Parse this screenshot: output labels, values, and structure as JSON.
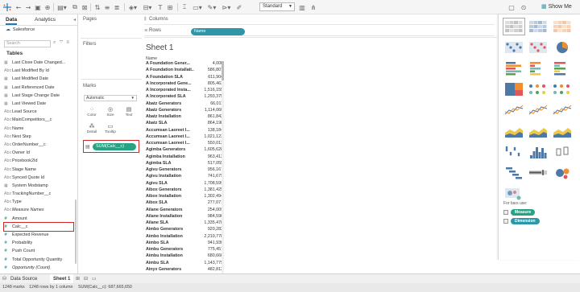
{
  "toolbar": {
    "mark_size_select": "Standard",
    "show_me_label": "Show Me"
  },
  "data_pane": {
    "tabs": [
      "Data",
      "Analytics"
    ],
    "datasource": "Salesforce",
    "search_placeholder": "Search",
    "tables_heading": "Tables",
    "fields": [
      {
        "name": "Last Close Date Changed...",
        "kind": "date"
      },
      {
        "name": "Last Modified By Id",
        "kind": "dim"
      },
      {
        "name": "Last Modified Date",
        "kind": "date"
      },
      {
        "name": "Last Referenced Date",
        "kind": "date"
      },
      {
        "name": "Last Stage Change Date",
        "kind": "date"
      },
      {
        "name": "Last Viewed Date",
        "kind": "date"
      },
      {
        "name": "Lead Source",
        "kind": "dim"
      },
      {
        "name": "MainCompetitors__c",
        "kind": "dim"
      },
      {
        "name": "Name",
        "kind": "dim"
      },
      {
        "name": "Next Step",
        "kind": "dim"
      },
      {
        "name": "OrderNumber__c",
        "kind": "dim"
      },
      {
        "name": "Owner Id",
        "kind": "dim"
      },
      {
        "name": "Pricebook2Id",
        "kind": "dim"
      },
      {
        "name": "Stage Name",
        "kind": "dim"
      },
      {
        "name": "Synced Quote Id",
        "kind": "dim"
      },
      {
        "name": "System Modstamp",
        "kind": "date"
      },
      {
        "name": "TrackingNumber__c",
        "kind": "dim"
      },
      {
        "name": "Type",
        "kind": "dim"
      },
      {
        "name": "Measure Names",
        "kind": "dim-italic"
      },
      {
        "name": "Amount",
        "kind": "measure"
      },
      {
        "name": "Calc__c",
        "kind": "measure"
      },
      {
        "name": "Expected Revenue",
        "kind": "measure"
      },
      {
        "name": "Probability",
        "kind": "measure"
      },
      {
        "name": "Push Count",
        "kind": "measure"
      },
      {
        "name": "Total Opportunity Quantity",
        "kind": "measure"
      },
      {
        "name": "Opportunity (Count)",
        "kind": "measure-italic"
      },
      {
        "name": "Measure Values",
        "kind": "measure-italic"
      }
    ],
    "selected_field": "Calc__c"
  },
  "cards": {
    "pages": "Pages",
    "filters": "Filters",
    "marks": "Marks",
    "mark_type": "Automatic",
    "mark_buttons": [
      "Color",
      "Size",
      "Text",
      "Detail",
      "Tooltip"
    ],
    "mark_pill": "SUM(Calc__c)"
  },
  "shelves": {
    "columns_label": "Columns",
    "rows_label": "Rows",
    "rows_pill": "Name"
  },
  "view": {
    "sheet_title": "Sheet 1",
    "column_header": "Name",
    "rows": [
      {
        "name": "A Foundation Gener...",
        "value": "4,000"
      },
      {
        "name": "A Foundation Installati...",
        "value": "586,807"
      },
      {
        "name": "A Foundation SLA",
        "value": "611,904"
      },
      {
        "name": "A Incorporated Gene...",
        "value": "805,463"
      },
      {
        "name": "A Incorporated Insta...",
        "value": "1,516,155"
      },
      {
        "name": "A Incorporated SLA",
        "value": "1,293,375"
      },
      {
        "name": "Abatz Generators",
        "value": "66,011"
      },
      {
        "name": "Abatz Generators",
        "value": "1,114,060"
      },
      {
        "name": "Abatz Installation",
        "value": "861,842"
      },
      {
        "name": "Abatz SLA",
        "value": "864,198"
      },
      {
        "name": "Accumsan Laoreet I...",
        "value": "138,184"
      },
      {
        "name": "Accumsan Laoreet I...",
        "value": "1,021,123"
      },
      {
        "name": "Accumsan Laoreet I...",
        "value": "550,013"
      },
      {
        "name": "Agimba Generators",
        "value": "1,605,628"
      },
      {
        "name": "Agimba Installation",
        "value": "963,412"
      },
      {
        "name": "Agimba SLA",
        "value": "517,055"
      },
      {
        "name": "Agivu Generators",
        "value": "956,167"
      },
      {
        "name": "Agivu Installation",
        "value": "741,679"
      },
      {
        "name": "Agivu SLA",
        "value": "1,708,599"
      },
      {
        "name": "Aibox Generators",
        "value": "1,381,425"
      },
      {
        "name": "Aibox Installation",
        "value": "1,302,494"
      },
      {
        "name": "Aibox SLA",
        "value": "277,071"
      },
      {
        "name": "Ailane Generators",
        "value": "254,009"
      },
      {
        "name": "Ailane Installation",
        "value": "984,596"
      },
      {
        "name": "Ailane SLA",
        "value": "1,335,478"
      },
      {
        "name": "Aimbo Generators",
        "value": "920,282"
      },
      {
        "name": "Aimbo Installation",
        "value": "2,210,778"
      },
      {
        "name": "Aimbo SLA",
        "value": "941,930"
      },
      {
        "name": "Aimbu Generators",
        "value": "775,457"
      },
      {
        "name": "Aimbu Installation",
        "value": "680,666"
      },
      {
        "name": "Aimbu SLA",
        "value": "1,143,779"
      },
      {
        "name": "Ainyx Generators",
        "value": "482,812"
      }
    ]
  },
  "show_me": {
    "hint_text": "For bars use:",
    "legend": [
      {
        "label": "Measure",
        "color": "#26a383"
      },
      {
        "label": "Dimension",
        "color": "#2f95a8"
      }
    ]
  },
  "tabs": {
    "data_source": "Data Source",
    "sheet": "Sheet 1"
  },
  "status": {
    "marks": "1248 marks",
    "rows_cols": "1248 rows by 1 column",
    "sum": "SUM(Calc__c): 687,665,650"
  },
  "colors": {
    "measure_pill": "#26a383",
    "dimension_pill": "#2f95a8",
    "highlight": "#d62728"
  }
}
